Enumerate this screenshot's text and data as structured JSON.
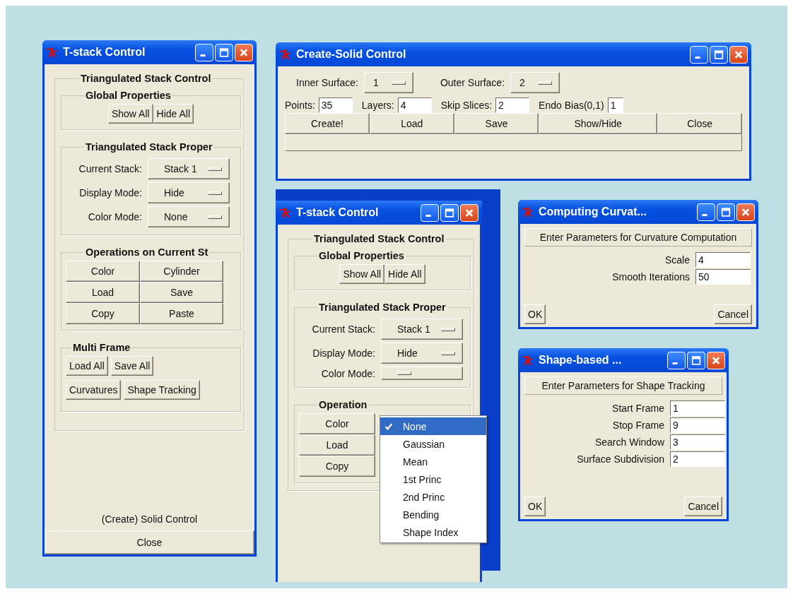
{
  "tstack_left": {
    "title": "T-stack Control",
    "frame_title": "Triangulated Stack Control",
    "global": {
      "title": "Global Properties",
      "buttons": [
        "Show All",
        "Hide All"
      ]
    },
    "properties": {
      "title": "Triangulated Stack Proper",
      "rows": [
        {
          "label": "Current Stack:",
          "value": "Stack 1"
        },
        {
          "label": "Display Mode:",
          "value": "Hide"
        },
        {
          "label": "Color Mode:",
          "value": "None"
        }
      ]
    },
    "operations": {
      "title": "Operations on Current St",
      "buttons": [
        "Color",
        "Cylinder",
        "Load",
        "Save",
        "Copy",
        "Paste"
      ]
    },
    "multi_frame": {
      "title": "Multi Frame",
      "buttons": [
        "Load All",
        "Save All",
        "Curvatures",
        "Shape Tracking"
      ]
    },
    "footer_label": "(Create) Solid Control",
    "close_button": "Close"
  },
  "create_solid": {
    "title": "Create-Solid Control",
    "selectors": [
      {
        "label": "Inner Surface:",
        "value": "1"
      },
      {
        "label": "Outer Surface:",
        "value": "2"
      }
    ],
    "fields": [
      {
        "label": "Points:",
        "value": "35"
      },
      {
        "label": "Layers:",
        "value": "4"
      },
      {
        "label": "Skip Slices:",
        "value": "2"
      },
      {
        "label": "Endo Bias(0,1)",
        "value": "1"
      }
    ],
    "buttons": [
      "Create!",
      "Load",
      "Save",
      "Show/Hide",
      "Close"
    ]
  },
  "tstack_middle": {
    "title": "T-stack Control",
    "frame_title": "Triangulated Stack Control",
    "global": {
      "title": "Global Properties",
      "buttons": [
        "Show All",
        "Hide All"
      ]
    },
    "properties": {
      "title": "Triangulated Stack Proper",
      "rows": [
        {
          "label": "Current Stack:",
          "value": "Stack 1"
        },
        {
          "label": "Display Mode:",
          "value": "Hide"
        },
        {
          "label": "Color Mode:"
        }
      ]
    },
    "operations": {
      "title": "Operation",
      "buttons": [
        "Color",
        "Load",
        "Copy"
      ]
    },
    "menu": [
      {
        "label": "None",
        "selected": true
      },
      {
        "label": "Gaussian",
        "selected": false
      },
      {
        "label": "Mean",
        "selected": false
      },
      {
        "label": "1st Princ",
        "selected": false
      },
      {
        "label": "2nd Princ",
        "selected": false
      },
      {
        "label": "Bending",
        "selected": false
      },
      {
        "label": "Shape Index",
        "selected": false
      }
    ]
  },
  "curvature_dialog": {
    "title": "Computing Curvat...",
    "heading": "Enter Parameters for Curvature Computation",
    "fields": [
      {
        "label": "Scale",
        "value": "4"
      },
      {
        "label": "Smooth Iterations",
        "value": "50"
      }
    ],
    "ok_button": "OK",
    "cancel_button": "Cancel"
  },
  "shape_dialog": {
    "title": "Shape-based ...",
    "heading": "Enter  Parameters for Shape Tracking",
    "fields": [
      {
        "label": "Start Frame",
        "value": "1"
      },
      {
        "label": "Stop  Frame",
        "value": "9"
      },
      {
        "label": "Search Window",
        "value": "3"
      },
      {
        "label": "Surface Subdivision",
        "value": "2"
      }
    ],
    "ok_button": "OK",
    "cancel_button": "Cancel"
  }
}
